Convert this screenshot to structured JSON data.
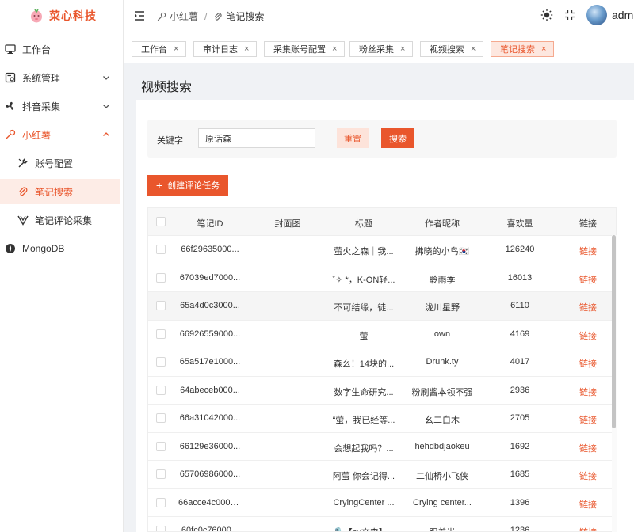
{
  "app": {
    "brand": "菜心科技",
    "user": "admin"
  },
  "breadcrumb": {
    "parent": "小红薯",
    "current": "笔记搜索"
  },
  "sidebar": {
    "workbench": "工作台",
    "system": "系统管理",
    "douyin": "抖音采集",
    "xhs": "小红薯",
    "account_config": "账号配置",
    "note_search": "笔记搜索",
    "note_comment": "笔记评论采集",
    "mongodb": "MongoDB"
  },
  "tabs": [
    {
      "label": "工作台",
      "close": "×"
    },
    {
      "label": "审计日志",
      "close": "×"
    },
    {
      "label": "采集账号配置",
      "close": "×"
    },
    {
      "label": "粉丝采集",
      "close": "×"
    },
    {
      "label": "视频搜索",
      "close": "×"
    },
    {
      "label": "笔记搜索",
      "close": "×"
    }
  ],
  "page": {
    "title": "视频搜索"
  },
  "filter": {
    "keyword_label": "关键字",
    "keyword_value": "原话森",
    "reset": "重置",
    "search": "搜索"
  },
  "create_button": {
    "icon": "+",
    "label": "创建评论任务"
  },
  "table": {
    "headers": {
      "note_id": "笔记ID",
      "cover": "封面图",
      "title": "标题",
      "author": "作者昵称",
      "likes": "喜欢量",
      "link": "链接"
    },
    "rows": [
      {
        "id": "66f29635000...",
        "title": "萤火之森｜我...",
        "author": "拂晓的小鸟🇰🇷",
        "likes": "126240",
        "link": "链接"
      },
      {
        "id": "67039ed7000...",
        "title": "˚✧ *，K-ON轻...",
        "author": "聆雨季",
        "likes": "16013",
        "link": "链接"
      },
      {
        "id": "65a4d0c3000...",
        "title": "不可结缘，徒...",
        "author": "泷川星野",
        "likes": "6110",
        "link": "链接"
      },
      {
        "id": "66926559000...",
        "title": "萤",
        "author": "own",
        "likes": "4169",
        "link": "链接"
      },
      {
        "id": "65a517e1000...",
        "title": "森么！14块的...",
        "author": "Drunk.ty",
        "likes": "4017",
        "link": "链接"
      },
      {
        "id": "64abeceb000...",
        "title": "数字生命研究...",
        "author": "粉刷酱本领不强",
        "likes": "2936",
        "link": "链接"
      },
      {
        "id": "66a31042000...",
        "title": "“萤，我已经等...",
        "author": "幺二白木",
        "likes": "2705",
        "link": "链接"
      },
      {
        "id": "66129e36000...",
        "title": "会想起我吗？...",
        "author": "hehdbdjaokeu",
        "likes": "1692",
        "link": "链接"
      },
      {
        "id": "65706986000...",
        "title": "阿萤 你会记得...",
        "author": "二仙桥小飞侠",
        "likes": "1685",
        "link": "链接"
      },
      {
        "id": "66acce4c0000...",
        "title": "CryingCenter ...",
        "author": "Crying center...",
        "likes": "1396",
        "link": "链接"
      },
      {
        "id": "60fc0c76000...",
        "title": "🎙️【cv文森】...",
        "author": "跟着光",
        "likes": "1236",
        "link": "链接"
      }
    ]
  },
  "colors": {
    "accent": "#e9562c",
    "accent_light": "#fde3da"
  }
}
